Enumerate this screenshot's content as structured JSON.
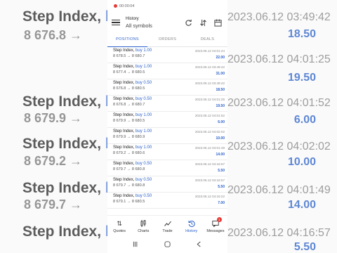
{
  "status_bar": {
    "record_time": "00:00:04"
  },
  "header": {
    "title": "History",
    "subtitle": "All symbols"
  },
  "tabs": [
    {
      "label": "POSITIONS",
      "active": true
    },
    {
      "label": "ORDERS",
      "active": false
    },
    {
      "label": "DEALS",
      "active": false
    }
  ],
  "deals": [
    {
      "symbol": "Step Index,",
      "side": "buy 1.00",
      "prices": "8 678.5 → 8 680.7",
      "time": "2023.06.12 04:01:24",
      "profit": "22.00"
    },
    {
      "symbol": "Step Index,",
      "side": "buy 1.00",
      "prices": "8 677.4 → 8 680.5",
      "time": "2023.06.12 03:49:42",
      "profit": "31.00"
    },
    {
      "symbol": "Step Index,",
      "side": "buy 0.50",
      "prices": "8 676.8 → 8 680.5",
      "time": "2023.06.12 03:49:42",
      "profit": "18.50"
    },
    {
      "symbol": "Step Index,",
      "side": "buy 0.50",
      "prices": "8 676.8 → 8 680.7",
      "time": "2023.06.12 04:01:25",
      "profit": "19.50"
    },
    {
      "symbol": "Step Index,",
      "side": "buy 1.00",
      "prices": "8 679.9 → 8 680.5",
      "time": "2023.06.12 04:01:52",
      "profit": "6.00"
    },
    {
      "symbol": "Step Index,",
      "side": "buy 1.00",
      "prices": "8 679.9 → 8 680.9",
      "time": "2023.06.12 04:02:02",
      "profit": "10.00"
    },
    {
      "symbol": "Step Index,",
      "side": "buy 1.00",
      "prices": "8 679.2 → 8 680.6",
      "time": "2023.06.12 04:01:49",
      "profit": "14.00"
    },
    {
      "symbol": "Step Index,",
      "side": "buy 0.50",
      "prices": "8 679.7 → 8 680.8",
      "time": "2023.06.12 04:16:57",
      "profit": "5.50"
    },
    {
      "symbol": "Step Index,",
      "side": "buy 0.50",
      "prices": "8 679.7 → 8 680.8",
      "time": "2023.06.12 04:16:57",
      "profit": "5.50"
    },
    {
      "symbol": "Step Index,",
      "side": "buy 0.50",
      "prices": "8 679.1 → 8 680.5",
      "time": "2023.06.12 04:16:22",
      "profit": "7.00"
    }
  ],
  "bottom_nav": [
    {
      "label": "Quotes",
      "icon": "quotes-icon",
      "active": false
    },
    {
      "label": "Charts",
      "icon": "charts-icon",
      "active": false
    },
    {
      "label": "Trade",
      "icon": "trade-icon",
      "active": false
    },
    {
      "label": "History",
      "icon": "history-icon",
      "active": true
    },
    {
      "label": "Messages",
      "icon": "messages-icon",
      "active": false,
      "badge": "1"
    }
  ],
  "background": {
    "left_rows": [
      {
        "symbol": "Step Index,",
        "side": "buy",
        "prices": "8 676.8 →"
      },
      {
        "symbol": "Step Index,",
        "side": "buy",
        "prices": "8 679.9 →"
      },
      {
        "symbol": "Step Index,",
        "side": "buy",
        "prices": "8 679.2 →"
      },
      {
        "symbol": "Step Index,",
        "side": "buy",
        "prices": "8 679.7 →"
      },
      {
        "symbol": "Step Index,",
        "side": "buy",
        "prices": ""
      }
    ],
    "right_rows": [
      {
        "time": "2023.06.12 03:49:42",
        "value": "18.50"
      },
      {
        "time": "2023.06.12 04:01:25",
        "value": "19.50"
      },
      {
        "time": "2023.06.12 04:01:52",
        "value": "6.00"
      },
      {
        "time": "2023.06.12 04:02:02",
        "value": "10.00"
      },
      {
        "time": "2023.06.12 04:01:49",
        "value": "14.00"
      },
      {
        "time": "2023.06.12 04:16:57",
        "value": "5.50"
      }
    ]
  },
  "colors": {
    "accent": "#2b61c9",
    "badge": "#e53935"
  }
}
